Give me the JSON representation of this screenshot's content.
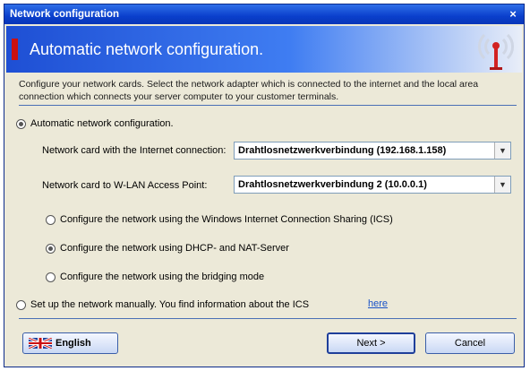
{
  "window": {
    "title": "Network configuration",
    "close_glyph": "×"
  },
  "banner": {
    "title": "Automatic network configuration.",
    "icon": "antenna-icon"
  },
  "description": "Configure your network cards. Select the network adapter which is connected to the internet and the local area connection which connects your server computer to your customer terminals.",
  "auto_option": {
    "label": "Automatic network configuration.",
    "selected": true
  },
  "internet_card": {
    "label": "Network card with the Internet connection:",
    "value": "Drahtlosnetzwerkverbindung (192.168.1.158)"
  },
  "wlan_card": {
    "label": "Network card to W-LAN Access Point:",
    "value": "Drahtlosnetzwerkverbindung 2 (10.0.0.1)"
  },
  "methods": [
    {
      "label": "Configure the network using the Windows Internet Connection Sharing (ICS)",
      "selected": false
    },
    {
      "label": "Configure the network using DHCP- and NAT-Server",
      "selected": true
    },
    {
      "label": "Configure the network using the bridging mode",
      "selected": false
    }
  ],
  "manual_option": {
    "label": "Set up the network manually. You find information about the ICS",
    "link": "here",
    "selected": false
  },
  "footer": {
    "language_label": "English",
    "next_label": "Next >",
    "cancel_label": "Cancel"
  },
  "colors": {
    "title_bar": "#0a3fcc",
    "accent_red": "#cc1010",
    "link": "#1a53c8"
  }
}
